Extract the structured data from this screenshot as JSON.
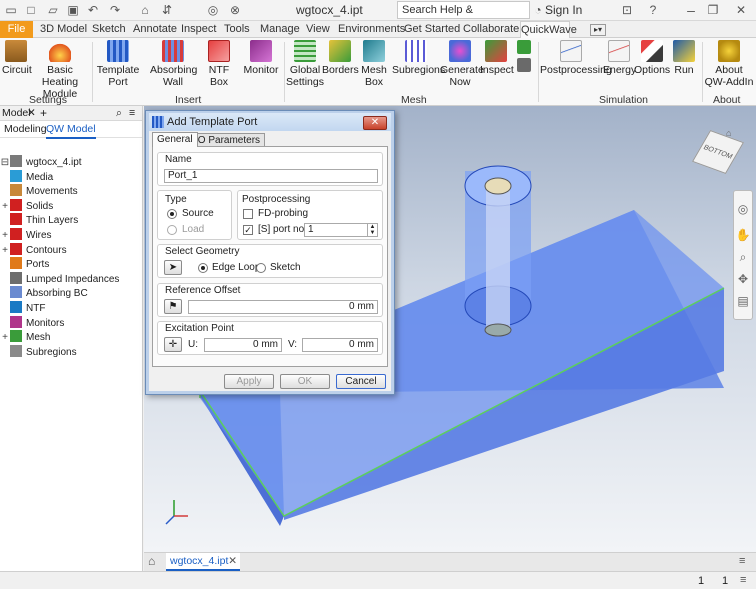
{
  "window": {
    "doc_title": "wgtocx_4.ipt",
    "search_placeholder": "Search Help & Commands...",
    "sign_in": "Sign In"
  },
  "tabs": [
    "File",
    "3D Model",
    "Sketch",
    "Annotate",
    "Inspect",
    "Tools",
    "Manage",
    "View",
    "Environments",
    "Get Started",
    "Collaborate",
    "QuickWave"
  ],
  "ribbon": {
    "settings": {
      "label": "Settings",
      "items": [
        "Circuit",
        "Basic Heating Module"
      ]
    },
    "insert": {
      "label": "Insert",
      "items": [
        "Template Port",
        "Absorbing Wall",
        "NTF Box",
        "Monitor"
      ]
    },
    "mesh": {
      "label": "Mesh",
      "items": [
        "Global Settings",
        "Borders",
        "Mesh Box",
        "Subregions",
        "Generate Now",
        "Inspect"
      ]
    },
    "simulation": {
      "label": "Simulation",
      "items": [
        "Postprocessing",
        "Energy",
        "Options",
        "Run"
      ]
    },
    "about": {
      "label": "About",
      "items": [
        "About QW-AddIn"
      ]
    }
  },
  "browser": {
    "header": "Model",
    "tabs": [
      "Modeling",
      "QW Model"
    ],
    "items": [
      "wgtocx_4.ipt",
      "Media",
      "Movements",
      "Solids",
      "Thin Layers",
      "Wires",
      "Contours",
      "Ports",
      "Lumped Impedances",
      "Absorbing BC",
      "NTF",
      "Monitors",
      "Mesh",
      "Subregions"
    ]
  },
  "dialog": {
    "title": "Add Template Port",
    "tabs": [
      "General",
      "IO Parameters"
    ],
    "name_label": "Name",
    "name_value": "Port_1",
    "type_label": "Type",
    "type_options": [
      "Source",
      "Load"
    ],
    "post_label": "Postprocessing",
    "fd_probing": "FD-probing",
    "s_port": "[S] port no.",
    "s_port_value": "1",
    "geom_label": "Select Geometry",
    "geom_options": [
      "Edge Loop",
      "Sketch"
    ],
    "ref_label": "Reference Offset",
    "ref_value": "0 mm",
    "exc_label": "Excitation Point",
    "u_label": "U:",
    "u_value": "0 mm",
    "v_label": "V:",
    "v_value": "0 mm",
    "apply": "Apply",
    "ok": "OK",
    "cancel": "Cancel"
  },
  "doc_tab": "wgtocx_4.ipt",
  "status": {
    "a": "1",
    "b": "1"
  },
  "viewcube": "BOTTOM"
}
